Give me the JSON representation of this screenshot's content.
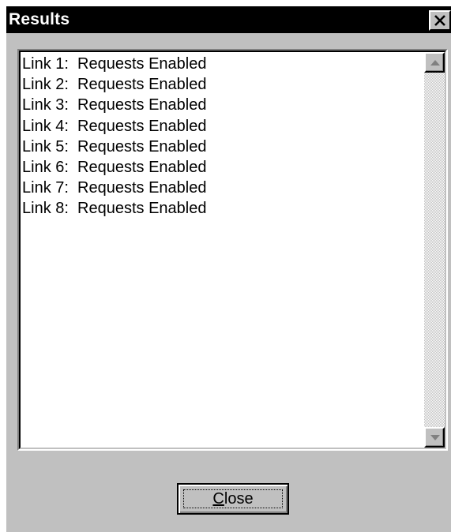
{
  "window": {
    "title": "Results",
    "close_icon": "close-icon"
  },
  "results_list": {
    "items": [
      "Link 1:  Requests Enabled",
      "Link 2:  Requests Enabled",
      "Link 3:  Requests Enabled",
      "Link 4:  Requests Enabled",
      "Link 5:  Requests Enabled",
      "Link 6:  Requests Enabled",
      "Link 7:  Requests Enabled",
      "Link 8:  Requests Enabled"
    ],
    "scroll_up_icon": "arrow-up-icon",
    "scroll_down_icon": "arrow-down-icon"
  },
  "close_button": {
    "label_mnemonic": "C",
    "label_rest": "lose"
  },
  "colors": {
    "titlebar": "#000000",
    "title_text": "#ffffff",
    "face": "#c0c0c0",
    "list_bg": "#ffffff"
  }
}
